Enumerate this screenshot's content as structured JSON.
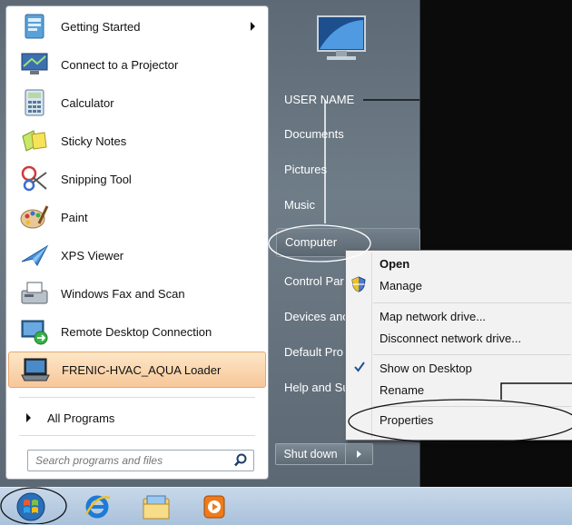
{
  "programs": [
    {
      "label": "Getting Started",
      "icon": "getting-started-icon",
      "submenu": true
    },
    {
      "label": "Connect to a Projector",
      "icon": "projector-icon"
    },
    {
      "label": "Calculator",
      "icon": "calculator-icon"
    },
    {
      "label": "Sticky Notes",
      "icon": "sticky-notes-icon"
    },
    {
      "label": "Snipping Tool",
      "icon": "snipping-tool-icon"
    },
    {
      "label": "Paint",
      "icon": "paint-icon"
    },
    {
      "label": "XPS Viewer",
      "icon": "xps-viewer-icon"
    },
    {
      "label": "Windows Fax and Scan",
      "icon": "fax-scan-icon"
    },
    {
      "label": "Remote Desktop Connection",
      "icon": "remote-desktop-icon"
    },
    {
      "label": "FRENIC-HVAC_AQUA Loader",
      "icon": "frenic-loader-icon",
      "highlighted": true
    }
  ],
  "all_programs": "All Programs",
  "search": {
    "placeholder": "Search programs and files"
  },
  "right_items": [
    {
      "label": "USER NAME"
    },
    {
      "label": "Documents"
    },
    {
      "label": "Pictures"
    },
    {
      "label": "Music"
    },
    {
      "label": "Computer",
      "hover": true
    },
    {
      "label": "Control Par"
    },
    {
      "label": "Devices anc"
    },
    {
      "label": "Default Pro"
    },
    {
      "label": "Help and Su"
    }
  ],
  "shutdown": {
    "label": "Shut down"
  },
  "context_menu": {
    "open": "Open",
    "manage": "Manage",
    "map_drive": "Map network drive...",
    "disconnect_drive": "Disconnect network drive...",
    "show_on_desktop": "Show on Desktop",
    "rename": "Rename",
    "properties": "Properties"
  },
  "colors": {
    "accent_highlight": "#f7c79a",
    "taskbar": "#b7cde3",
    "menu_frame": "#66737e"
  }
}
